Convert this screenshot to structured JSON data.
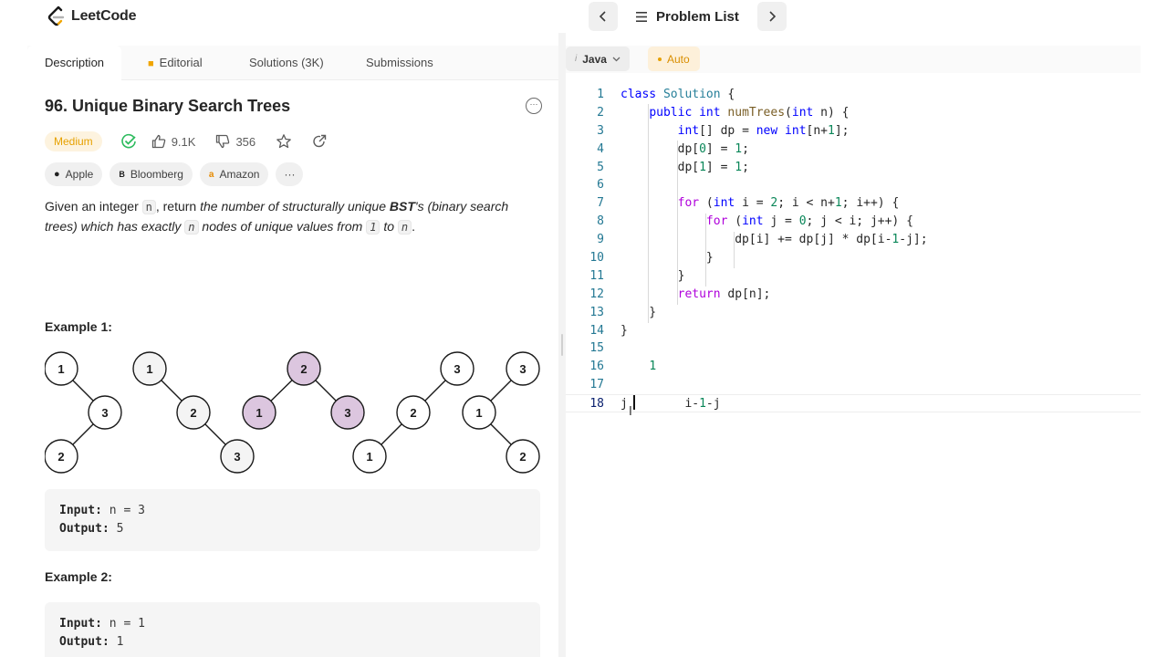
{
  "header": {
    "logo_text": "LeetCode",
    "prev_icon": "chevron-left-icon",
    "next_icon": "chevron-right-icon",
    "problem_list_label": "Problem List",
    "problem_list_icon": "list-icon"
  },
  "tabs": [
    {
      "label": "Description",
      "active": true
    },
    {
      "label": "Editorial",
      "icon": "lock-icon"
    },
    {
      "label": "Solutions (3K)"
    },
    {
      "label": "Submissions"
    }
  ],
  "problem": {
    "title": "96. Unique Binary Search Trees",
    "difficulty": "Medium",
    "difficulty_color": "#e6a100",
    "likes": "9.1K",
    "dislikes": "356",
    "companies": [
      "Apple",
      "Bloomberg",
      "Amazon"
    ],
    "companies_more": "···",
    "description": {
      "p1": "Given an integer ",
      "code_n": "n",
      "p2": ", return ",
      "p3": "the number of structurally unique ",
      "bst": "BST",
      "p4": "'s (binary search trees) which has exactly ",
      "code_n2": "n",
      "p5": " nodes of unique values from ",
      "code_1": "1",
      "p6": " to ",
      "code_n3": "n",
      "p7": "."
    },
    "example1_title": "Example 1:",
    "example1_input_label": "Input:",
    "example1_input": " n = 3",
    "example1_output_label": "Output:",
    "example1_output": " 5",
    "example2_title": "Example 2:",
    "example2_input_label": "Input:",
    "example2_input": " n = 1",
    "example2_output_label": "Output:",
    "example2_output": " 1",
    "tree_labels": {
      "t1": [
        "1",
        "3",
        "2"
      ],
      "t2": [
        "1",
        "2",
        "3"
      ],
      "t3": [
        "2",
        "1",
        "3"
      ],
      "t4": [
        "3",
        "2",
        "1"
      ],
      "t5": [
        "3",
        "1",
        "2"
      ]
    },
    "highlight_color": "#dcc6df"
  },
  "editor": {
    "language": "Java",
    "auto_label": "Auto",
    "auto_color": "#e6a100",
    "line_numbers": [
      "1",
      "2",
      "3",
      "4",
      "5",
      "6",
      "7",
      "8",
      "9",
      "10",
      "11",
      "12",
      "13",
      "14",
      "15",
      "16",
      "17",
      "18"
    ],
    "current_line": "18"
  }
}
